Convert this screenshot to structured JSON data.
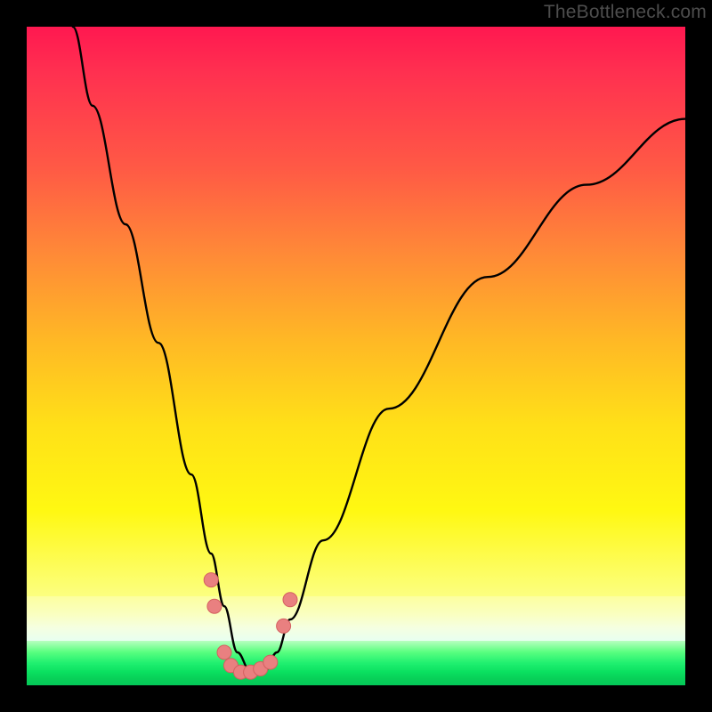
{
  "attribution": "TheBottleneck.com",
  "colors": {
    "frame": "#000000",
    "gradient_top": "#ff1850",
    "gradient_mid": "#ffe018",
    "gradient_bottom": "#04c858",
    "curve_stroke": "#000000",
    "marker_fill": "#e98080",
    "marker_stroke": "#d46060"
  },
  "chart_data": {
    "type": "line",
    "title": "",
    "xlabel": "",
    "ylabel": "",
    "xlim": [
      0,
      100
    ],
    "ylim": [
      0,
      100
    ],
    "grid": false,
    "notes": "Unlabeled axes. y-values are estimated heights of the V-shaped curve as a percentage of the plot height; minimum of the curve is at roughly x≈33. Markers lie along the curve near the trough.",
    "series": [
      {
        "name": "curve",
        "x": [
          7,
          10,
          15,
          20,
          25,
          28,
          30,
          32,
          34,
          36,
          38,
          40,
          45,
          55,
          70,
          85,
          100
        ],
        "y": [
          100,
          88,
          70,
          52,
          32,
          20,
          12,
          5,
          2,
          2,
          5,
          10,
          22,
          42,
          62,
          76,
          86
        ]
      }
    ],
    "markers": {
      "note": "approximate (x,y) positions of salmon-colored dotted markers near the curve minimum",
      "points": [
        {
          "x": 28,
          "y": 16
        },
        {
          "x": 28.5,
          "y": 12
        },
        {
          "x": 30,
          "y": 5
        },
        {
          "x": 31,
          "y": 3
        },
        {
          "x": 32.5,
          "y": 2
        },
        {
          "x": 34,
          "y": 2
        },
        {
          "x": 35.5,
          "y": 2.5
        },
        {
          "x": 37,
          "y": 3.5
        },
        {
          "x": 39,
          "y": 9
        },
        {
          "x": 40,
          "y": 13
        }
      ]
    }
  }
}
